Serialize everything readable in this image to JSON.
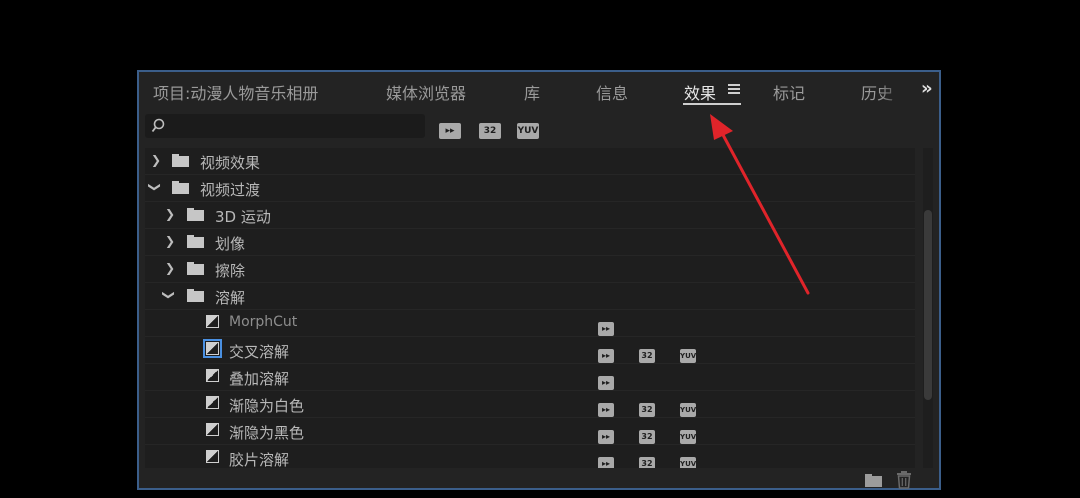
{
  "tabs": [
    {
      "label": "项目:动漫人物音乐相册",
      "active": false
    },
    {
      "label": "媒体浏览器",
      "active": false
    },
    {
      "label": "库",
      "active": false
    },
    {
      "label": "信息",
      "active": false
    },
    {
      "label": "效果",
      "active": true
    },
    {
      "label": "标记",
      "active": false
    },
    {
      "label": "历史",
      "active": false
    }
  ],
  "overflow": "»",
  "search": {
    "placeholder": "",
    "value": ""
  },
  "filters": {
    "accelerated": "",
    "bit32": "32",
    "yuv": "YUV"
  },
  "tree": [
    {
      "label": "视频效果",
      "expanded": false,
      "level": 0,
      "type": "folder"
    },
    {
      "label": "视频过渡",
      "expanded": true,
      "level": 0,
      "type": "folder"
    },
    {
      "label": "3D 运动",
      "expanded": false,
      "level": 1,
      "type": "folder"
    },
    {
      "label": "划像",
      "expanded": false,
      "level": 1,
      "type": "folder"
    },
    {
      "label": "擦除",
      "expanded": false,
      "level": 1,
      "type": "folder"
    },
    {
      "label": "溶解",
      "expanded": true,
      "level": 1,
      "type": "folder"
    },
    {
      "label": "MorphCut",
      "type": "effect",
      "accel": true,
      "b32": false,
      "yuv": false
    },
    {
      "label": "交叉溶解",
      "type": "effect",
      "selected": true,
      "accel": true,
      "b32": true,
      "yuv": true
    },
    {
      "label": "叠加溶解",
      "type": "effect",
      "accel": true,
      "b32": false,
      "yuv": false
    },
    {
      "label": "渐隐为白色",
      "type": "effect",
      "accel": true,
      "b32": true,
      "yuv": true
    },
    {
      "label": "渐隐为黑色",
      "type": "effect",
      "accel": true,
      "b32": true,
      "yuv": true
    },
    {
      "label": "胶片溶解",
      "type": "effect",
      "accel": true,
      "b32": true,
      "yuv": true
    }
  ],
  "colors": {
    "panel_border": "#3b5e8a",
    "annotation_arrow": "#e0242a"
  }
}
